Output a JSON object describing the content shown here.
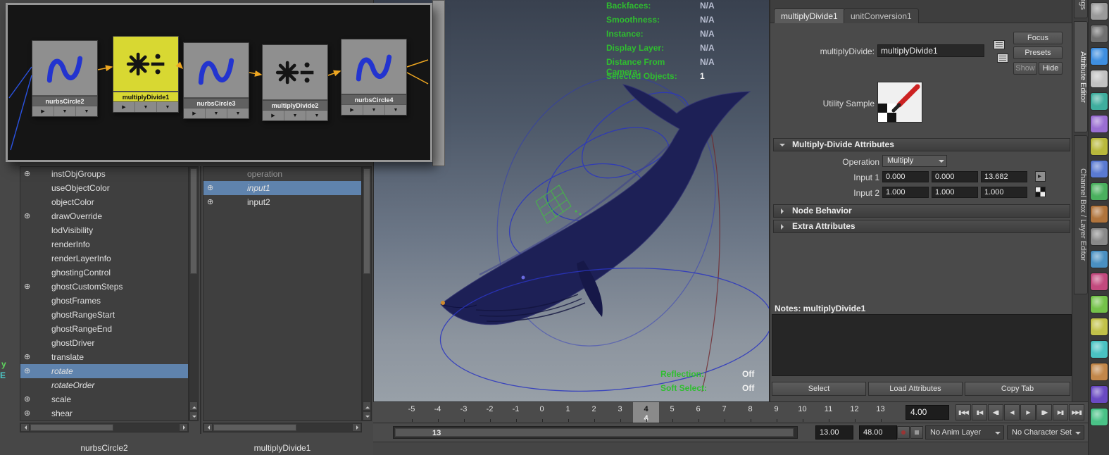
{
  "colors": {
    "selection_yellow": "#d8d832",
    "highlight_blue": "#5f83ad",
    "hud_green": "#2fbe2f",
    "connection_orange": "#eda621",
    "whale_navy": "#1d2056",
    "curve_blue": "#2334cf"
  },
  "hypergraph_window": {
    "nodes": [
      {
        "name": "nurbsCircle2",
        "mult": false,
        "selected": false
      },
      {
        "name": "multiplyDivide1",
        "mult": true,
        "selected": true
      },
      {
        "name": "nurbsCircle3",
        "mult": false,
        "selected": false
      },
      {
        "name": "multiplyDivide2",
        "mult": true,
        "selected": false
      },
      {
        "name": "nurbsCircle4",
        "mult": false,
        "selected": false
      }
    ]
  },
  "connection_editor": {
    "left_column": {
      "items": [
        {
          "label": "instObjGroups",
          "plus": true
        },
        {
          "label": "useObjectColor"
        },
        {
          "label": "objectColor"
        },
        {
          "label": "drawOverride",
          "plus": true
        },
        {
          "label": "lodVisibility"
        },
        {
          "label": "renderInfo"
        },
        {
          "label": "renderLayerInfo"
        },
        {
          "label": "ghostingControl"
        },
        {
          "label": "ghostCustomSteps",
          "plus": true
        },
        {
          "label": "ghostFrames"
        },
        {
          "label": "ghostRangeStart"
        },
        {
          "label": "ghostRangeEnd"
        },
        {
          "label": "ghostDriver"
        },
        {
          "label": "translate",
          "plus": true
        },
        {
          "label": "rotate",
          "plus": true,
          "selected": true,
          "italic": true
        },
        {
          "label": "rotateOrder",
          "italic": true
        },
        {
          "label": "scale",
          "plus": true
        },
        {
          "label": "shear",
          "plus": true
        }
      ],
      "footer": "nurbsCircle2"
    },
    "right_column": {
      "items": [
        {
          "label": "operation",
          "disabled": true
        },
        {
          "label": "input1",
          "plus": true,
          "selected": true,
          "italic": true
        },
        {
          "label": "input2",
          "plus": true
        }
      ],
      "footer": "multiplyDivide1"
    }
  },
  "viewport": {
    "hud_top": [
      {
        "label": "Backfaces:",
        "value": "N/A"
      },
      {
        "label": "Smoothness:",
        "value": "N/A"
      },
      {
        "label": "Instance:",
        "value": "N/A"
      },
      {
        "label": "Display Layer:",
        "value": "N/A"
      },
      {
        "label": "Distance From Camera:",
        "value": "N/A"
      },
      {
        "label": "Selected Objects:",
        "value": "1",
        "strong": true
      }
    ],
    "hud_bottom": [
      {
        "label": "Reflection:",
        "value": "Off",
        "strong": true
      },
      {
        "label": "Soft Select:",
        "value": "Off",
        "strong": true
      }
    ],
    "stray_labels": {
      "top": "y",
      "bottom": "E"
    }
  },
  "attribute_editor": {
    "tabs": [
      {
        "label": "multiplyDivide1",
        "active": true
      },
      {
        "label": "unitConversion1",
        "active": false
      }
    ],
    "node_name_label": "multiplyDivide:",
    "node_name_value": "multiplyDivide1",
    "focus_button": "Focus",
    "presets_button": "Presets",
    "show_button": "Show",
    "hide_button": "Hide",
    "utility_sample_label": "Utility Sample",
    "sections": {
      "multiply_divide": "Multiply-Divide Attributes",
      "node_behavior": "Node Behavior",
      "extra_attributes": "Extra Attributes"
    },
    "operation": {
      "label": "Operation",
      "value": "Multiply"
    },
    "input1": {
      "label": "Input 1",
      "values": [
        "0.000",
        "0.000",
        "13.682"
      ]
    },
    "input2": {
      "label": "Input 2",
      "values": [
        "1.000",
        "1.000",
        "1.000"
      ]
    },
    "notes_label": "Notes: multiplyDivide1",
    "select_button": "Select",
    "load_attributes_button": "Load Attributes",
    "copy_tab_button": "Copy Tab"
  },
  "side_tabs": [
    {
      "label": "Tool Settings"
    },
    {
      "label": "Attribute Editor",
      "active": true
    },
    {
      "label": "Channel Box / Layer Editor"
    }
  ],
  "sidebar_icon_colors": [
    "#9a9a9a",
    "#707070",
    "#3f8fe0",
    "#c2c2c2",
    "#3fae9e",
    "#9a6fd2",
    "#b9b93c",
    "#5a7ad2",
    "#4ab05e",
    "#b0743c",
    "#8a8a8a",
    "#4a90c2",
    "#c24a7e",
    "#74c24a",
    "#c2c24a",
    "#4ac2c2",
    "#c2874a",
    "#6a4ac2",
    "#4ac287"
  ],
  "timeline": {
    "ticks": [
      {
        "label": "-5"
      },
      {
        "label": "-4"
      },
      {
        "label": "-3"
      },
      {
        "label": "-2"
      },
      {
        "label": "-1"
      },
      {
        "label": "0"
      },
      {
        "label": "1"
      },
      {
        "label": "2"
      },
      {
        "label": "3"
      },
      {
        "label": "4",
        "current": true
      },
      {
        "label": "5"
      },
      {
        "label": "6"
      },
      {
        "label": "7"
      },
      {
        "label": "8"
      },
      {
        "label": "9"
      },
      {
        "label": "10"
      },
      {
        "label": "11"
      },
      {
        "label": "12"
      },
      {
        "label": "13"
      }
    ],
    "current_time": "4.00",
    "playback_buttons": [
      {
        "glyph": "▮◀◀",
        "name": "go-to-start-button"
      },
      {
        "glyph": "▮◀",
        "name": "step-back-key-button"
      },
      {
        "glyph": "◀▮",
        "name": "step-back-frame-button"
      },
      {
        "glyph": "◀",
        "name": "play-backwards-button"
      },
      {
        "glyph": "▶",
        "name": "play-forwards-button"
      },
      {
        "glyph": "▮▶",
        "name": "step-forward-frame-button"
      },
      {
        "glyph": "▶▮",
        "name": "step-forward-key-button"
      },
      {
        "glyph": "▶▶▮",
        "name": "go-to-end-button"
      }
    ]
  },
  "range_bar": {
    "bar_label": "13",
    "range_start": "13.00",
    "range_end": "48.00",
    "anim_layer": "No Anim Layer",
    "character_set": "No Character Set"
  }
}
